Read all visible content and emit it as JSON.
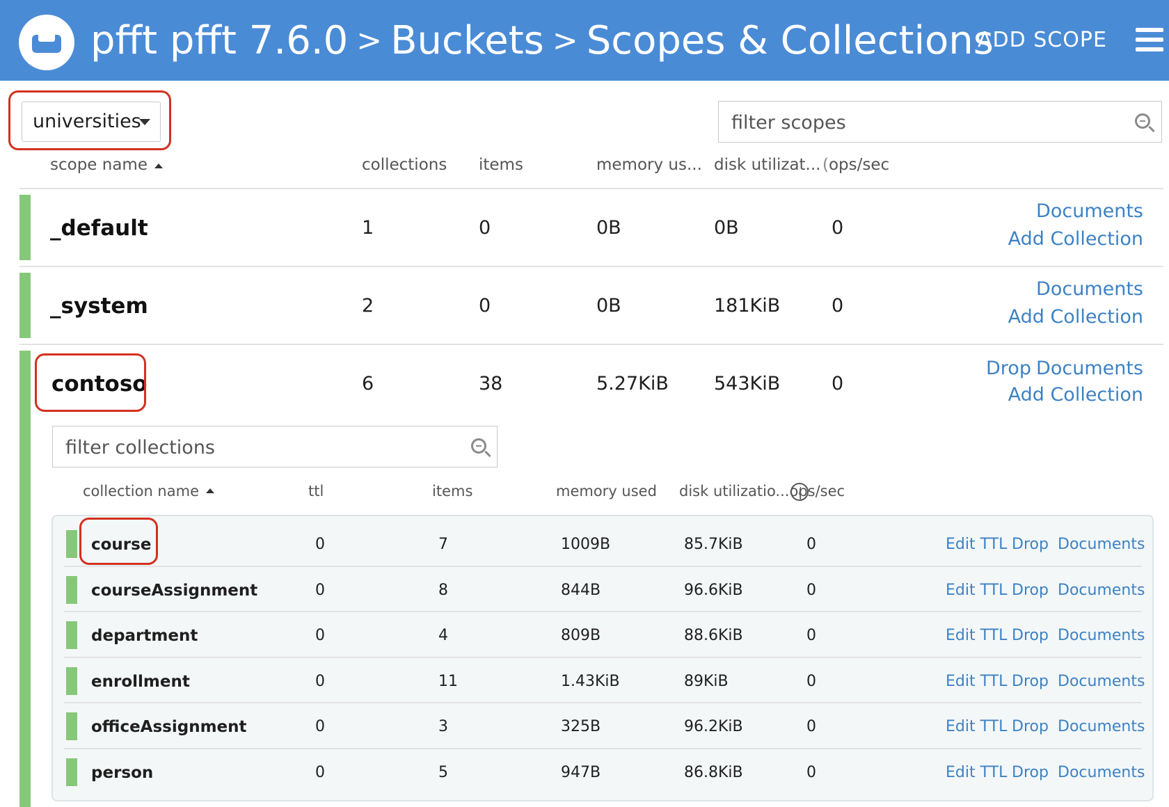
{
  "header": {
    "breadcrumbs": [
      "pfft pfft 7.6.0",
      "Buckets",
      "Scopes & Collections"
    ],
    "add_scope_label": "ADD SCOPE",
    "accent": "#4a8bd6"
  },
  "bucket_select": {
    "value": "universities"
  },
  "filter_scopes": {
    "placeholder": "filter scopes"
  },
  "scope_columns": {
    "name": "scope name",
    "collections": "collections",
    "items": "items",
    "memory": "memory us...",
    "disk": "disk utilizat...",
    "ops": "ops/sec"
  },
  "scopes": [
    {
      "name": "_default",
      "collections": "1",
      "items": "0",
      "memory": "0B",
      "disk": "0B",
      "ops": "0",
      "actions": {
        "documents": "Documents",
        "add_collection": "Add Collection"
      }
    },
    {
      "name": "_system",
      "collections": "2",
      "items": "0",
      "memory": "0B",
      "disk": "181KiB",
      "ops": "0",
      "actions": {
        "documents": "Documents",
        "add_collection": "Add Collection"
      }
    },
    {
      "name": "contoso",
      "collections": "6",
      "items": "38",
      "memory": "5.27KiB",
      "disk": "543KiB",
      "ops": "0",
      "actions": {
        "drop": "Drop",
        "documents": "Documents",
        "add_collection": "Add Collection"
      }
    }
  ],
  "filter_collections": {
    "placeholder": "filter collections"
  },
  "collection_columns": {
    "name": "collection name",
    "ttl": "ttl",
    "items": "items",
    "memory": "memory used",
    "disk": "disk utilizatio...",
    "ops": "ops/sec"
  },
  "collection_actions": {
    "edit_ttl": "Edit TTL",
    "drop": "Drop",
    "documents": "Documents"
  },
  "collections": [
    {
      "name": "course",
      "ttl": "0",
      "items": "7",
      "memory": "1009B",
      "disk": "85.7KiB",
      "ops": "0"
    },
    {
      "name": "courseAssignment",
      "ttl": "0",
      "items": "8",
      "memory": "844B",
      "disk": "96.6KiB",
      "ops": "0"
    },
    {
      "name": "department",
      "ttl": "0",
      "items": "4",
      "memory": "809B",
      "disk": "88.6KiB",
      "ops": "0"
    },
    {
      "name": "enrollment",
      "ttl": "0",
      "items": "11",
      "memory": "1.43KiB",
      "disk": "89KiB",
      "ops": "0"
    },
    {
      "name": "officeAssignment",
      "ttl": "0",
      "items": "3",
      "memory": "325B",
      "disk": "96.2KiB",
      "ops": "0"
    },
    {
      "name": "person",
      "ttl": "0",
      "items": "5",
      "memory": "947B",
      "disk": "86.8KiB",
      "ops": "0"
    }
  ]
}
